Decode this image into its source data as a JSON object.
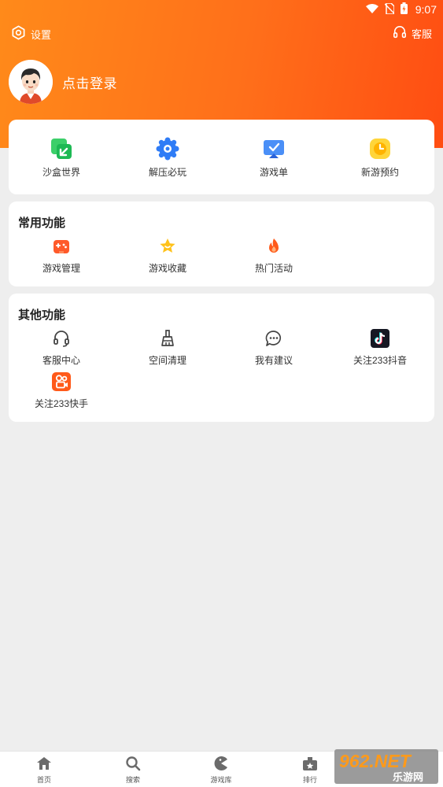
{
  "status": {
    "time": "9:07"
  },
  "topbar": {
    "settings_label": "设置",
    "service_label": "客服"
  },
  "profile": {
    "login_label": "点击登录"
  },
  "quick_items": [
    {
      "label": "沙盒世界",
      "icon": "sandbox-icon"
    },
    {
      "label": "解压必玩",
      "icon": "decompress-icon"
    },
    {
      "label": "游戏单",
      "icon": "game-list-icon"
    },
    {
      "label": "新游预约",
      "icon": "new-game-reservation-icon"
    }
  ],
  "common": {
    "title": "常用功能",
    "items": [
      {
        "label": "游戏管理",
        "icon": "gamepad-icon"
      },
      {
        "label": "游戏收藏",
        "icon": "star-icon"
      },
      {
        "label": "热门活动",
        "icon": "fire-icon"
      }
    ]
  },
  "other": {
    "title": "其他功能",
    "items": [
      {
        "label": "客服中心",
        "icon": "headset-icon"
      },
      {
        "label": "空间清理",
        "icon": "broom-icon"
      },
      {
        "label": "我有建议",
        "icon": "chat-bubble-icon"
      },
      {
        "label": "关注233抖音",
        "icon": "tiktok-icon"
      },
      {
        "label": "关注233快手",
        "icon": "kuaishou-icon"
      }
    ]
  },
  "bottom_nav": [
    {
      "label": "首页",
      "icon": "home-icon"
    },
    {
      "label": "搜索",
      "icon": "search-icon"
    },
    {
      "label": "游戏库",
      "icon": "game-library-icon"
    },
    {
      "label": "排行",
      "icon": "ranking-icon"
    }
  ],
  "watermark": {
    "text_top": "962.NET",
    "text_bottom": "乐游网"
  },
  "colors": {
    "header_start": "#ff8a1a",
    "header_end": "#ff4d12",
    "background": "#eeeeee",
    "accent": "#ff6a1a"
  }
}
